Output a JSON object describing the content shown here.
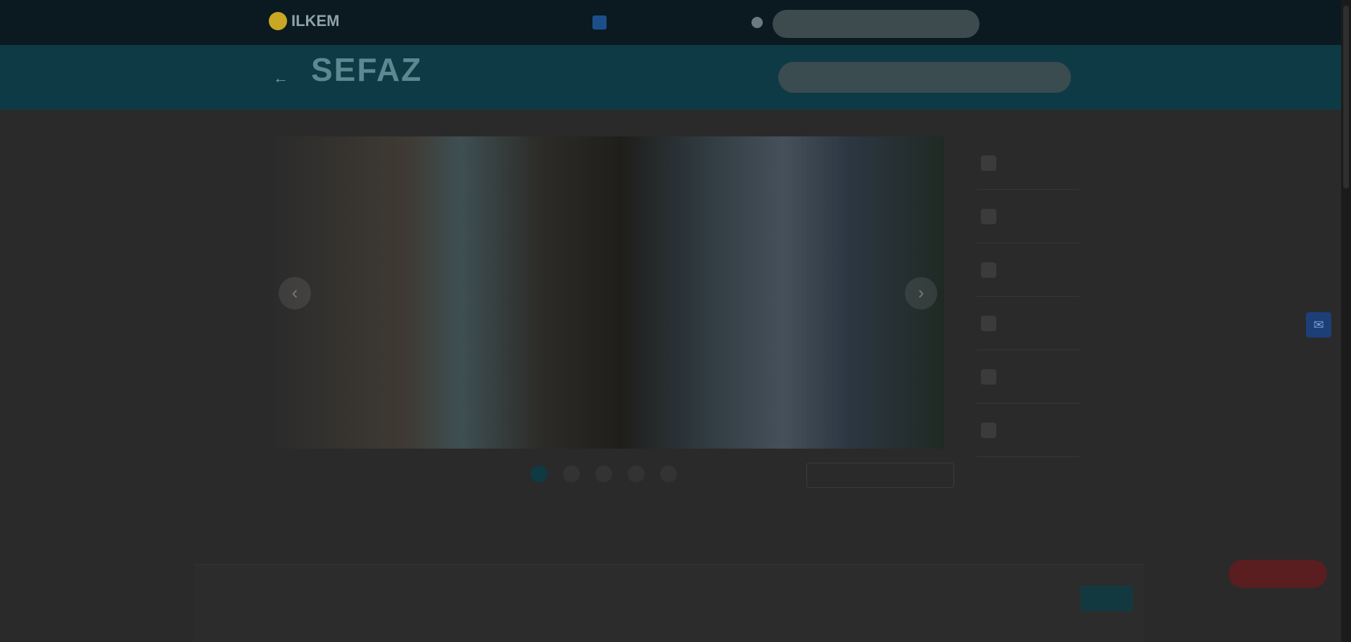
{
  "header": {
    "logo_text": "ILKEM",
    "logo_subtext": "",
    "nav_link_1": "",
    "nav_link_2": "",
    "language": "",
    "search_placeholder": ""
  },
  "subheader": {
    "title": "SEFAZ",
    "subtitle": "",
    "search_placeholder": ""
  },
  "hero": {
    "caption": "",
    "date": "",
    "dot_count": 5,
    "active_dot": 1,
    "all_news_label": ""
  },
  "sidebar": {
    "items": [
      {
        "label": ""
      },
      {
        "label": ""
      },
      {
        "label": ""
      },
      {
        "label": ""
      },
      {
        "label": ""
      },
      {
        "label": ""
      }
    ]
  },
  "main": {
    "section_title": ""
  },
  "cookie_banner": {
    "text": "",
    "link_label": "",
    "preferences_label": "",
    "accept_label": ""
  },
  "colors": {
    "topbar": "#0a1a20",
    "subheader": "#0e3a45",
    "accent_gold": "#c9a623",
    "overlay": "#2a2a2a"
  },
  "icons": [
    "back-arrow-icon",
    "user-icon",
    "chevron-left-icon",
    "chevron-right-icon",
    "chat-icon"
  ]
}
